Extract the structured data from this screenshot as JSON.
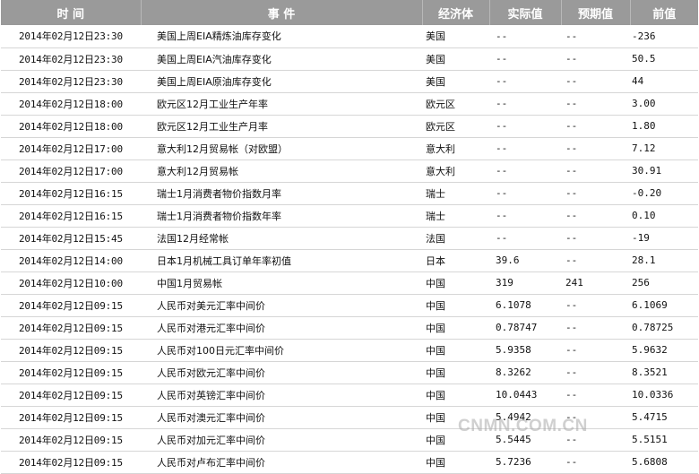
{
  "columns": {
    "time": "时 间",
    "event": "事 件",
    "economy": "经济体",
    "actual": "实际值",
    "forecast": "预期值",
    "previous": "前值"
  },
  "rows": [
    {
      "time": "2014年02月12日23:30",
      "event": "美国上周EIA精炼油库存变化",
      "economy": "美国",
      "actual": "--",
      "forecast": "--",
      "previous": "-236"
    },
    {
      "time": "2014年02月12日23:30",
      "event": "美国上周EIA汽油库存变化",
      "economy": "美国",
      "actual": "--",
      "forecast": "--",
      "previous": "50.5"
    },
    {
      "time": "2014年02月12日23:30",
      "event": "美国上周EIA原油库存变化",
      "economy": "美国",
      "actual": "--",
      "forecast": "--",
      "previous": "44"
    },
    {
      "time": "2014年02月12日18:00",
      "event": "欧元区12月工业生产年率",
      "economy": "欧元区",
      "actual": "--",
      "forecast": "--",
      "previous": "3.00"
    },
    {
      "time": "2014年02月12日18:00",
      "event": "欧元区12月工业生产月率",
      "economy": "欧元区",
      "actual": "--",
      "forecast": "--",
      "previous": "1.80"
    },
    {
      "time": "2014年02月12日17:00",
      "event": "意大利12月贸易帐（对欧盟）",
      "economy": "意大利",
      "actual": "--",
      "forecast": "--",
      "previous": "7.12"
    },
    {
      "time": "2014年02月12日17:00",
      "event": "意大利12月贸易帐",
      "economy": "意大利",
      "actual": "--",
      "forecast": "--",
      "previous": "30.91"
    },
    {
      "time": "2014年02月12日16:15",
      "event": "瑞士1月消费者物价指数月率",
      "economy": "瑞士",
      "actual": "--",
      "forecast": "--",
      "previous": "-0.20"
    },
    {
      "time": "2014年02月12日16:15",
      "event": "瑞士1月消费者物价指数年率",
      "economy": "瑞士",
      "actual": "--",
      "forecast": "--",
      "previous": "0.10"
    },
    {
      "time": "2014年02月12日15:45",
      "event": "法国12月经常帐",
      "economy": "法国",
      "actual": "--",
      "forecast": "--",
      "previous": "-19"
    },
    {
      "time": "2014年02月12日14:00",
      "event": "日本1月机械工具订单年率初值",
      "economy": "日本",
      "actual": "39.6",
      "forecast": "--",
      "previous": "28.1"
    },
    {
      "time": "2014年02月12日10:00",
      "event": "中国1月贸易帐",
      "economy": "中国",
      "actual": "319",
      "forecast": "241",
      "previous": "256"
    },
    {
      "time": "2014年02月12日09:15",
      "event": "人民币对美元汇率中间价",
      "economy": "中国",
      "actual": "6.1078",
      "forecast": "--",
      "previous": "6.1069"
    },
    {
      "time": "2014年02月12日09:15",
      "event": "人民币对港元汇率中间价",
      "economy": "中国",
      "actual": "0.78747",
      "forecast": "--",
      "previous": "0.78725"
    },
    {
      "time": "2014年02月12日09:15",
      "event": "人民币对100日元汇率中间价",
      "economy": "中国",
      "actual": "5.9358",
      "forecast": "--",
      "previous": "5.9632"
    },
    {
      "time": "2014年02月12日09:15",
      "event": "人民币对欧元汇率中间价",
      "economy": "中国",
      "actual": "8.3262",
      "forecast": "--",
      "previous": "8.3521"
    },
    {
      "time": "2014年02月12日09:15",
      "event": "人民币对英镑汇率中间价",
      "economy": "中国",
      "actual": "10.0443",
      "forecast": "--",
      "previous": "10.0336"
    },
    {
      "time": "2014年02月12日09:15",
      "event": "人民币对澳元汇率中间价",
      "economy": "中国",
      "actual": "5.4942",
      "forecast": "--",
      "previous": "5.4715"
    },
    {
      "time": "2014年02月12日09:15",
      "event": "人民币对加元汇率中间价",
      "economy": "中国",
      "actual": "5.5445",
      "forecast": "--",
      "previous": "5.5151"
    },
    {
      "time": "2014年02月12日09:15",
      "event": "人民币对卢布汇率中间价",
      "economy": "中国",
      "actual": "5.7236",
      "forecast": "--",
      "previous": "5.6808"
    }
  ],
  "watermark": "CNMN.COM.CN"
}
